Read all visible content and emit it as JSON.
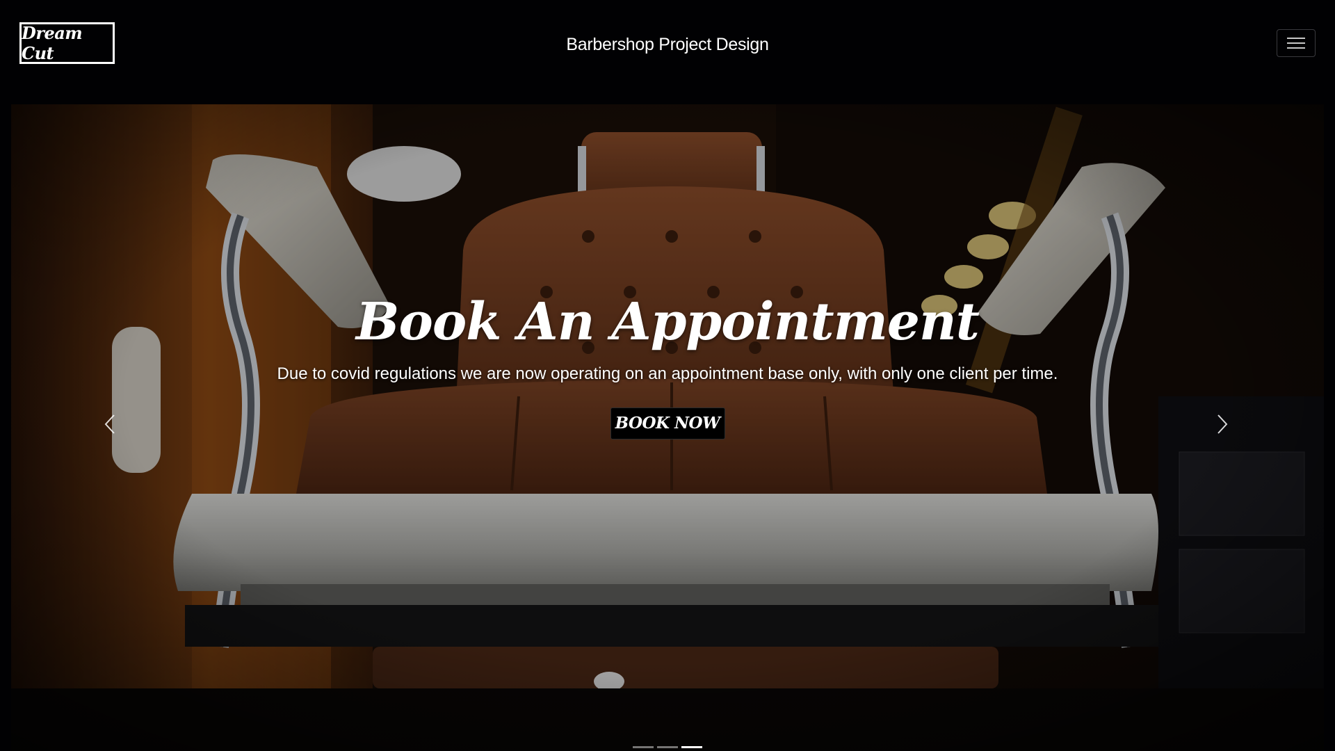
{
  "navbar": {
    "brand": "Dream Cut",
    "title": "Barbershop Project Design",
    "toggler_icon": "hamburger-menu-icon"
  },
  "hero": {
    "title": "Book An Appointment",
    "text": "Due to covid regulations we are now operating on an appointment base only, with only one client per time.",
    "button": "BOOK NOW",
    "prev_icon": "chevron-left-icon",
    "next_icon": "chevron-right-icon",
    "slide_count": 3,
    "active_slide": 3
  },
  "colors": {
    "background": "#010103",
    "text": "#ffffff",
    "leather": "#6b3a1f",
    "chrome": "#cfd3d8"
  }
}
